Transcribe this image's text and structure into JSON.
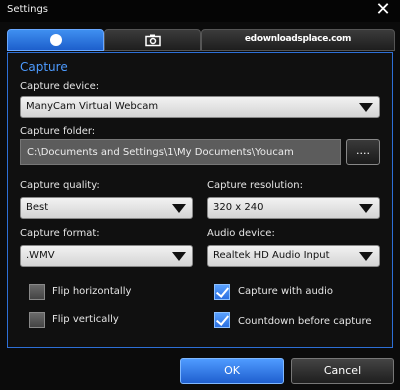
{
  "window": {
    "title": "Settings"
  },
  "tabs": [
    {
      "icon": "record-icon"
    },
    {
      "icon": "camera-icon"
    },
    {
      "icon": "video-icon",
      "text": "edownloadsplace.com"
    }
  ],
  "section": {
    "title": "Capture"
  },
  "capture_device": {
    "label": "Capture device:",
    "value": "ManyCam Virtual Webcam"
  },
  "capture_folder": {
    "label": "Capture folder:",
    "value": "C:\\Documents and Settings\\1\\My Documents\\Youcam",
    "browse_label": "...."
  },
  "capture_quality": {
    "label": "Capture quality:",
    "value": "Best"
  },
  "capture_resolution": {
    "label": "Capture resolution:",
    "value": "320 x 240"
  },
  "capture_format": {
    "label": "Capture format:",
    "value": ".WMV"
  },
  "audio_device": {
    "label": "Audio device:",
    "value": "Realtek HD Audio Input"
  },
  "options": {
    "flip_horizontally": {
      "label": "Flip horizontally",
      "checked": false
    },
    "flip_vertically": {
      "label": "Flip vertically",
      "checked": false
    },
    "capture_with_audio": {
      "label": "Capture with audio",
      "checked": true
    },
    "countdown": {
      "label": "Countdown before capture",
      "checked": true
    }
  },
  "buttons": {
    "ok": "OK",
    "cancel": "Cancel"
  },
  "colors": {
    "accent": "#2d6fd6",
    "section_title": "#4d9bff",
    "background": "#0b0b0b"
  }
}
